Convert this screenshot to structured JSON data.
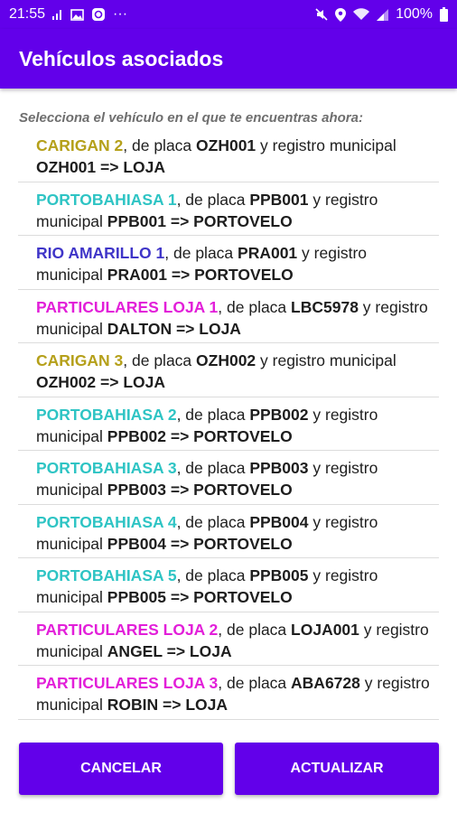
{
  "status_bar": {
    "time": "21:55",
    "more": "···",
    "battery": "100%",
    "icons": [
      "signal-bars-icon",
      "image-icon",
      "app-notification-icon",
      "mute-icon",
      "location-icon",
      "wifi-icon",
      "cell-signal-icon",
      "battery-icon"
    ]
  },
  "app_bar": {
    "title": "Vehículos asociados",
    "color": "#6200ea"
  },
  "instruction": "Selecciona el vehículo en el que te encuentras ahora:",
  "vehicles": [
    {
      "name": "CARIGAN 2",
      "mid1": ", de placa ",
      "plate": "OZH001",
      "mid2": " y registro municipal ",
      "registry": "OZH001",
      "arrow": " => ",
      "city": "LOJA",
      "color": "gold"
    },
    {
      "name": "PORTOBAHIASA 1",
      "mid1": ", de placa ",
      "plate": "PPB001",
      "mid2": " y registro municipal ",
      "registry": "PPB001",
      "arrow": " => ",
      "city": "PORTOVELO",
      "color": "cyan"
    },
    {
      "name": "RIO AMARILLO 1",
      "mid1": ", de placa ",
      "plate": "PRA001",
      "mid2": " y registro municipal ",
      "registry": "PRA001",
      "arrow": " => ",
      "city": "PORTOVELO",
      "color": "blue"
    },
    {
      "name": "PARTICULARES LOJA 1",
      "mid1": ", de placa ",
      "plate": "LBC5978",
      "mid2": " y registro municipal ",
      "registry": "DALTON",
      "arrow": " => ",
      "city": "LOJA",
      "color": "magenta"
    },
    {
      "name": "CARIGAN 3",
      "mid1": ", de placa ",
      "plate": "OZH002",
      "mid2": " y registro municipal ",
      "registry": "OZH002",
      "arrow": " => ",
      "city": "LOJA",
      "color": "gold"
    },
    {
      "name": "PORTOBAHIASA 2",
      "mid1": ", de placa ",
      "plate": "PPB002",
      "mid2": " y registro municipal ",
      "registry": "PPB002",
      "arrow": " => ",
      "city": "PORTOVELO",
      "color": "cyan"
    },
    {
      "name": "PORTOBAHIASA 3",
      "mid1": ", de placa ",
      "plate": "PPB003",
      "mid2": " y registro municipal ",
      "registry": "PPB003",
      "arrow": " => ",
      "city": "PORTOVELO",
      "color": "cyan"
    },
    {
      "name": "PORTOBAHIASA 4",
      "mid1": ", de placa ",
      "plate": "PPB004",
      "mid2": " y registro municipal ",
      "registry": "PPB004",
      "arrow": " => ",
      "city": "PORTOVELO",
      "color": "cyan"
    },
    {
      "name": "PORTOBAHIASA 5",
      "mid1": ", de placa ",
      "plate": "PPB005",
      "mid2": " y registro municipal ",
      "registry": "PPB005",
      "arrow": " => ",
      "city": "PORTOVELO",
      "color": "cyan"
    },
    {
      "name": "PARTICULARES LOJA 2",
      "mid1": ", de placa ",
      "plate": "LOJA001",
      "mid2": " y registro municipal ",
      "registry": "ANGEL",
      "arrow": " => ",
      "city": "LOJA",
      "color": "magenta"
    },
    {
      "name": "PARTICULARES LOJA 3",
      "mid1": ", de placa ",
      "plate": "ABA6728",
      "mid2": " y registro municipal ",
      "registry": "ROBIN",
      "arrow": " => ",
      "city": "LOJA",
      "color": "magenta"
    }
  ],
  "buttons": {
    "cancel": "CANCELAR",
    "update": "ACTUALIZAR"
  },
  "colors": {
    "primary": "#6200ea",
    "gold": "#b5a01a",
    "cyan": "#2ec4c4",
    "blue": "#3f35c8",
    "magenta": "#e21fd9"
  }
}
